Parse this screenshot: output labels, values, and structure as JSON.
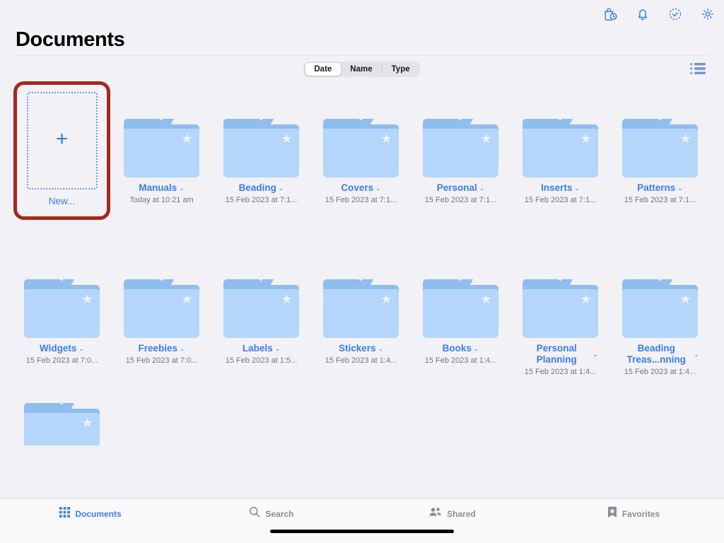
{
  "header": {
    "title": "Documents",
    "icons": [
      {
        "name": "recents-bag-clock-icon"
      },
      {
        "name": "notifications-bell-icon"
      },
      {
        "name": "sync-status-check-icon"
      },
      {
        "name": "settings-gear-icon"
      }
    ]
  },
  "toolbar": {
    "sort_options": [
      {
        "label": "Date",
        "selected": true
      },
      {
        "label": "Name",
        "selected": false
      },
      {
        "label": "Type",
        "selected": false
      }
    ],
    "view_toggle": "list-view-icon"
  },
  "new_tile": {
    "label": "New...",
    "plus": "+",
    "highlighted": true,
    "highlight_color": "#a5281b"
  },
  "colors": {
    "accent": "#3b7ded",
    "folder_tab": "#8fbdee",
    "folder_body": "#b4d6fa",
    "background": "#f2f1f6",
    "highlight": "#a5281b"
  },
  "rows": [
    {
      "items": [
        {
          "name": "Manuals",
          "date": "Today at 10:21 am",
          "chevron": "⌄",
          "starred": true
        },
        {
          "name": "Beading",
          "date": "15 Feb 2023 at 7:1...",
          "chevron": "⌄",
          "starred": true
        },
        {
          "name": "Covers",
          "date": "15 Feb 2023 at 7:1...",
          "chevron": "⌄",
          "starred": true
        },
        {
          "name": "Personal",
          "date": "15 Feb 2023 at 7:1...",
          "chevron": "⌄",
          "starred": true
        },
        {
          "name": "Inserts",
          "date": "15 Feb 2023 at 7:1...",
          "chevron": "⌄",
          "starred": true
        },
        {
          "name": "Patterns",
          "date": "15 Feb 2023 at 7:1...",
          "chevron": "⌄",
          "starred": true
        }
      ]
    },
    {
      "items": [
        {
          "name": "Widgets",
          "date": "15 Feb 2023 at 7:0...",
          "chevron": "⌄",
          "starred": true
        },
        {
          "name": "Freebies",
          "date": "15 Feb 2023 at 7:0...",
          "chevron": "⌄",
          "starred": true
        },
        {
          "name": "Labels",
          "date": "15 Feb 2023 at 1:5...",
          "chevron": "⌄",
          "starred": true
        },
        {
          "name": "Stickers",
          "date": "15 Feb 2023 at 1:4...",
          "chevron": "⌄",
          "starred": true
        },
        {
          "name": "Books",
          "date": "15 Feb 2023 at 1:4...",
          "chevron": "⌄",
          "starred": true
        },
        {
          "name": "Personal Planning",
          "date": "15 Feb 2023 at 1:4...",
          "chevron": "⌄",
          "starred": true
        },
        {
          "name": "Beading Treas...nning",
          "date": "15 Feb 2023 at 1:4...",
          "chevron": "⌄",
          "starred": true
        }
      ]
    }
  ],
  "tabbar": {
    "tabs": [
      {
        "label": "Documents",
        "icon": "grid-icon",
        "active": true
      },
      {
        "label": "Search",
        "icon": "search-icon",
        "active": false
      },
      {
        "label": "Shared",
        "icon": "people-icon",
        "active": false
      },
      {
        "label": "Favorites",
        "icon": "bookmark-star-icon",
        "active": false
      }
    ]
  }
}
